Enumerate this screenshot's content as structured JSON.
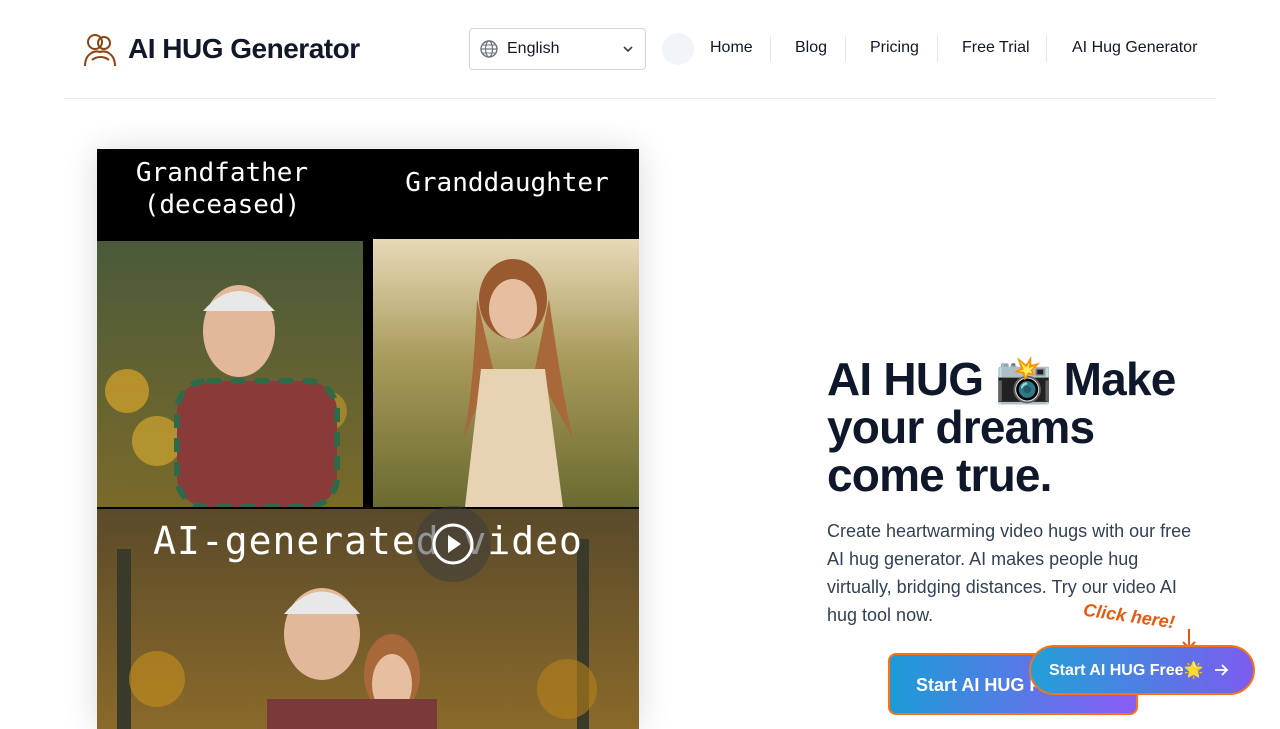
{
  "header": {
    "logo_text": "AI HUG Generator",
    "language": {
      "selected": "English"
    },
    "nav": [
      "Home",
      "Blog",
      "Pricing",
      "Free Trial",
      "AI Hug Generator"
    ]
  },
  "media": {
    "caption_left": "Grandfather\n(deceased)",
    "caption_right": "Granddaughter",
    "overlay_caption": "AI-generated video"
  },
  "hero": {
    "title_part1": "AI HUG",
    "title_emoji": "📸",
    "title_part2": "Make your dreams come true.",
    "description": "Create heartwarming video hugs with our free AI hug generator. AI makes people hug virtually, bridging distances. Try our video AI hug tool now."
  },
  "cta": {
    "under_label": "Start AI HUG F",
    "top_label": "Start AI HUG Free🌟",
    "hint": "Click here!"
  },
  "colors": {
    "accent_orange": "#f97316",
    "gradient_start": "#22a0d6",
    "gradient_end": "#7c5cf0"
  }
}
